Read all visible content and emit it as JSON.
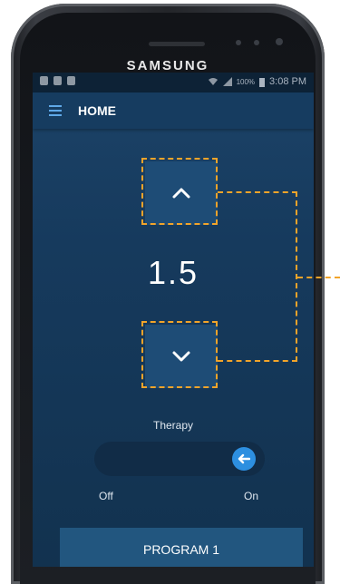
{
  "device": {
    "brand": "SAMSUNG"
  },
  "status_bar": {
    "battery": "100%",
    "time": "3:08 PM"
  },
  "app_bar": {
    "title": "HOME",
    "menu_icon": "hamburger-menu-icon"
  },
  "control": {
    "up_icon": "chevron-up-icon",
    "down_icon": "chevron-down-icon",
    "value": "1.5"
  },
  "therapy": {
    "label": "Therapy",
    "off_label": "Off",
    "on_label": "On",
    "state": "on",
    "knob_icon": "arrow-left-icon"
  },
  "program_button": {
    "label": "PROGRAM 1"
  },
  "colors": {
    "accent": "#2d8fe0",
    "annotation": "#f2a42a",
    "screen_background": "#163a5d"
  }
}
